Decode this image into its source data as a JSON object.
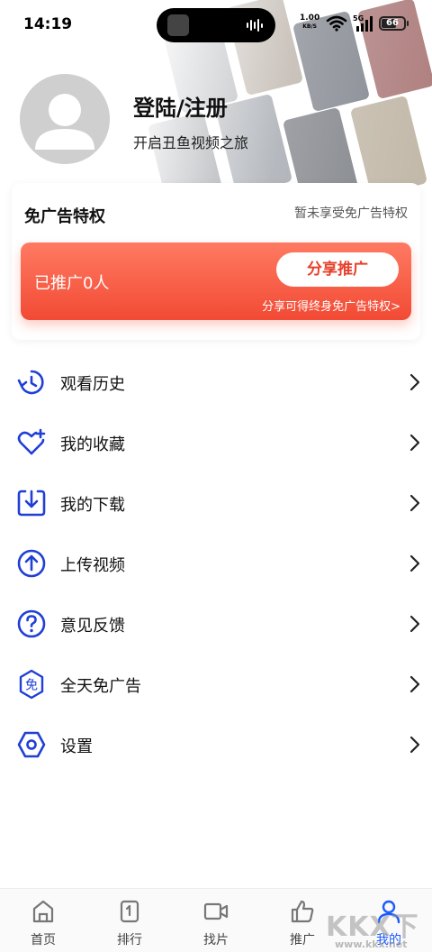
{
  "status_bar": {
    "time": "14:19",
    "net_speed_value": "1.00",
    "net_speed_unit": "KB/S",
    "network_type": "5G",
    "battery": "66",
    "battery_level": 0.66
  },
  "profile": {
    "title": "登陆/注册",
    "subtitle": "开启丑鱼视频之旅"
  },
  "adfree": {
    "title": "免广告特权",
    "status": "暂未享受免广告特权",
    "promo_count": "已推广0人",
    "share_button": "分享推广",
    "promo_note": "分享可得终身免广告特权>"
  },
  "menu": [
    {
      "label": "观看历史",
      "icon": "history-icon"
    },
    {
      "label": "我的收藏",
      "icon": "favorite-heart-icon"
    },
    {
      "label": "我的下载",
      "icon": "download-icon"
    },
    {
      "label": "上传视频",
      "icon": "upload-icon"
    },
    {
      "label": "意见反馈",
      "icon": "feedback-question-icon"
    },
    {
      "label": "全天免广告",
      "icon": "ad-free-badge-icon"
    },
    {
      "label": "设置",
      "icon": "settings-hex-icon"
    }
  ],
  "bottom_nav": [
    {
      "label": "首页",
      "icon": "home-icon",
      "active": false
    },
    {
      "label": "排行",
      "icon": "ranking-icon",
      "active": false
    },
    {
      "label": "找片",
      "icon": "video-camera-icon",
      "active": false
    },
    {
      "label": "推广",
      "icon": "thumbs-up-icon",
      "active": false
    },
    {
      "label": "我的",
      "icon": "user-icon",
      "active": true
    }
  ],
  "watermark": {
    "main": "KKX下载",
    "sub": "www.kkx.net"
  },
  "colors": {
    "accent": "#1a5cff",
    "promo_red": "#f24a34",
    "menu_icon_blue": "#1f3fd6"
  }
}
